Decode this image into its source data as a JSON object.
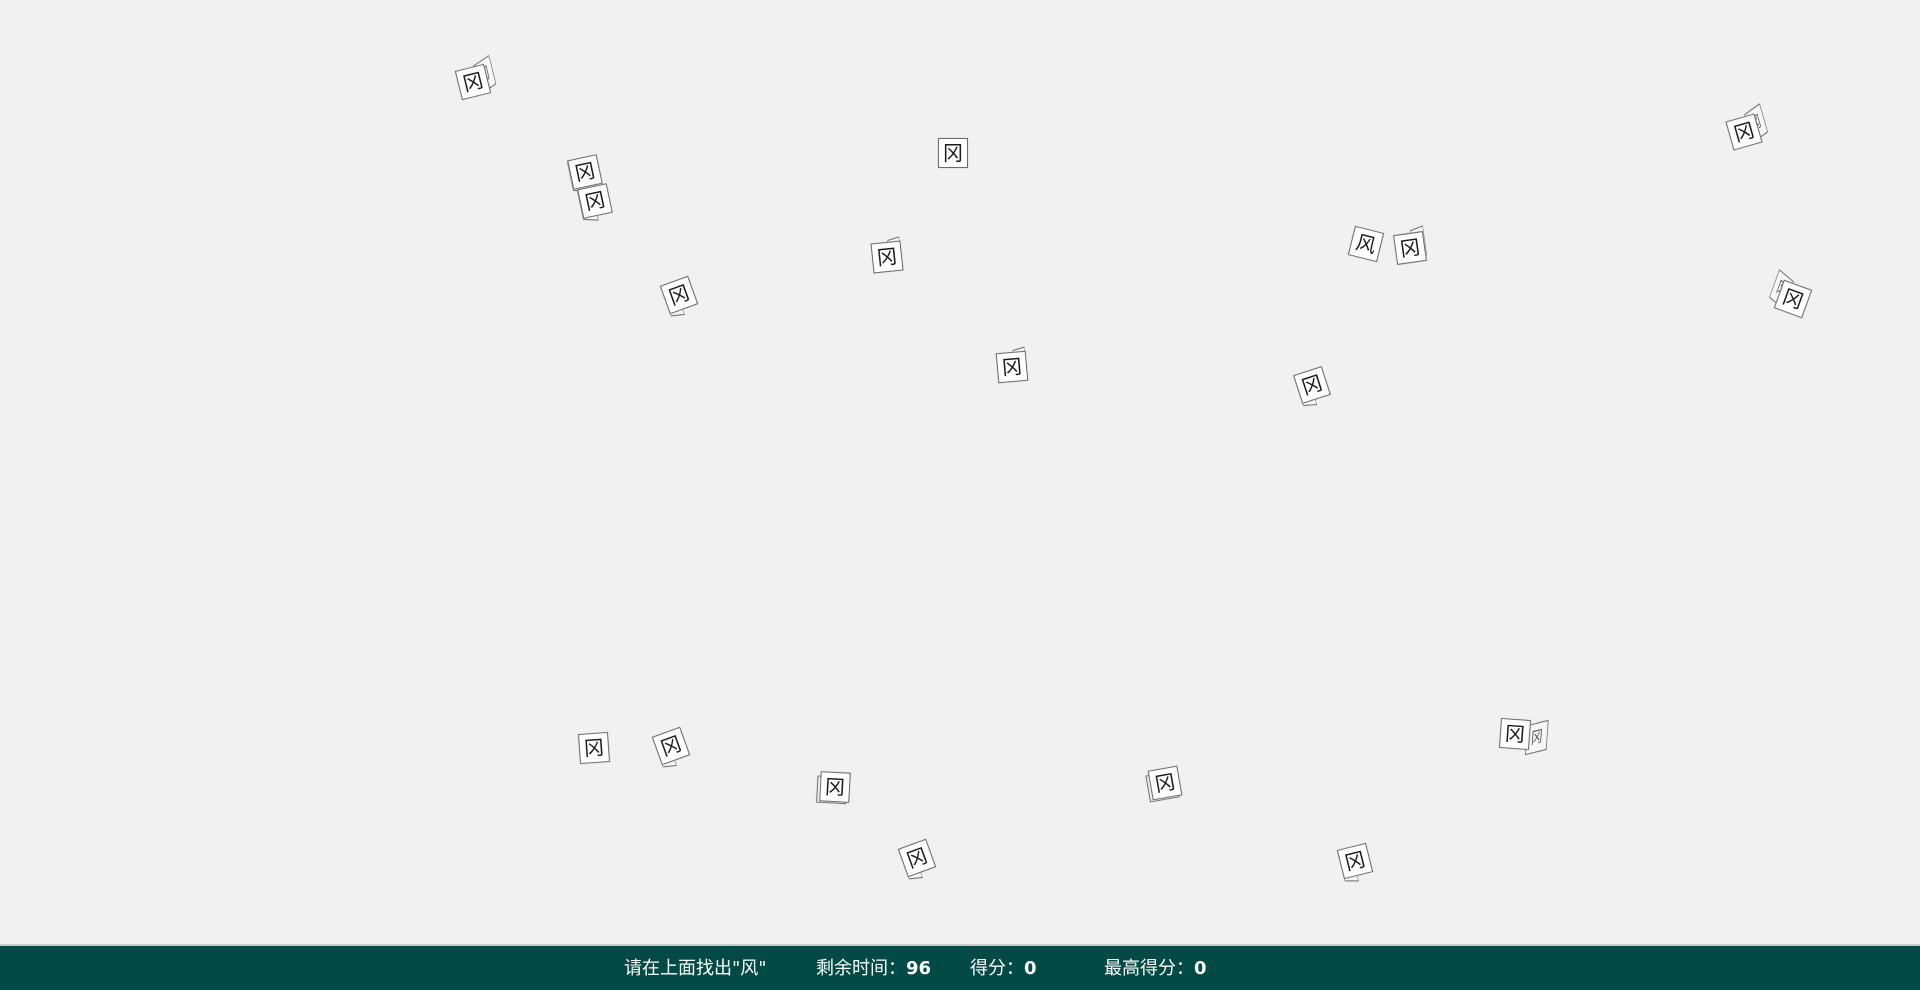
{
  "game": {
    "cube_chars": {
      "distractor": "冈",
      "target": "风"
    }
  },
  "status_bar": {
    "prompt_prefix": "请在上面找出",
    "target_char": "\"风\"",
    "time_label": "剩余时间：",
    "time_value": "96",
    "score_label": "得分：",
    "score_value": "0",
    "best_label": "最高得分：",
    "best_value": "0"
  }
}
